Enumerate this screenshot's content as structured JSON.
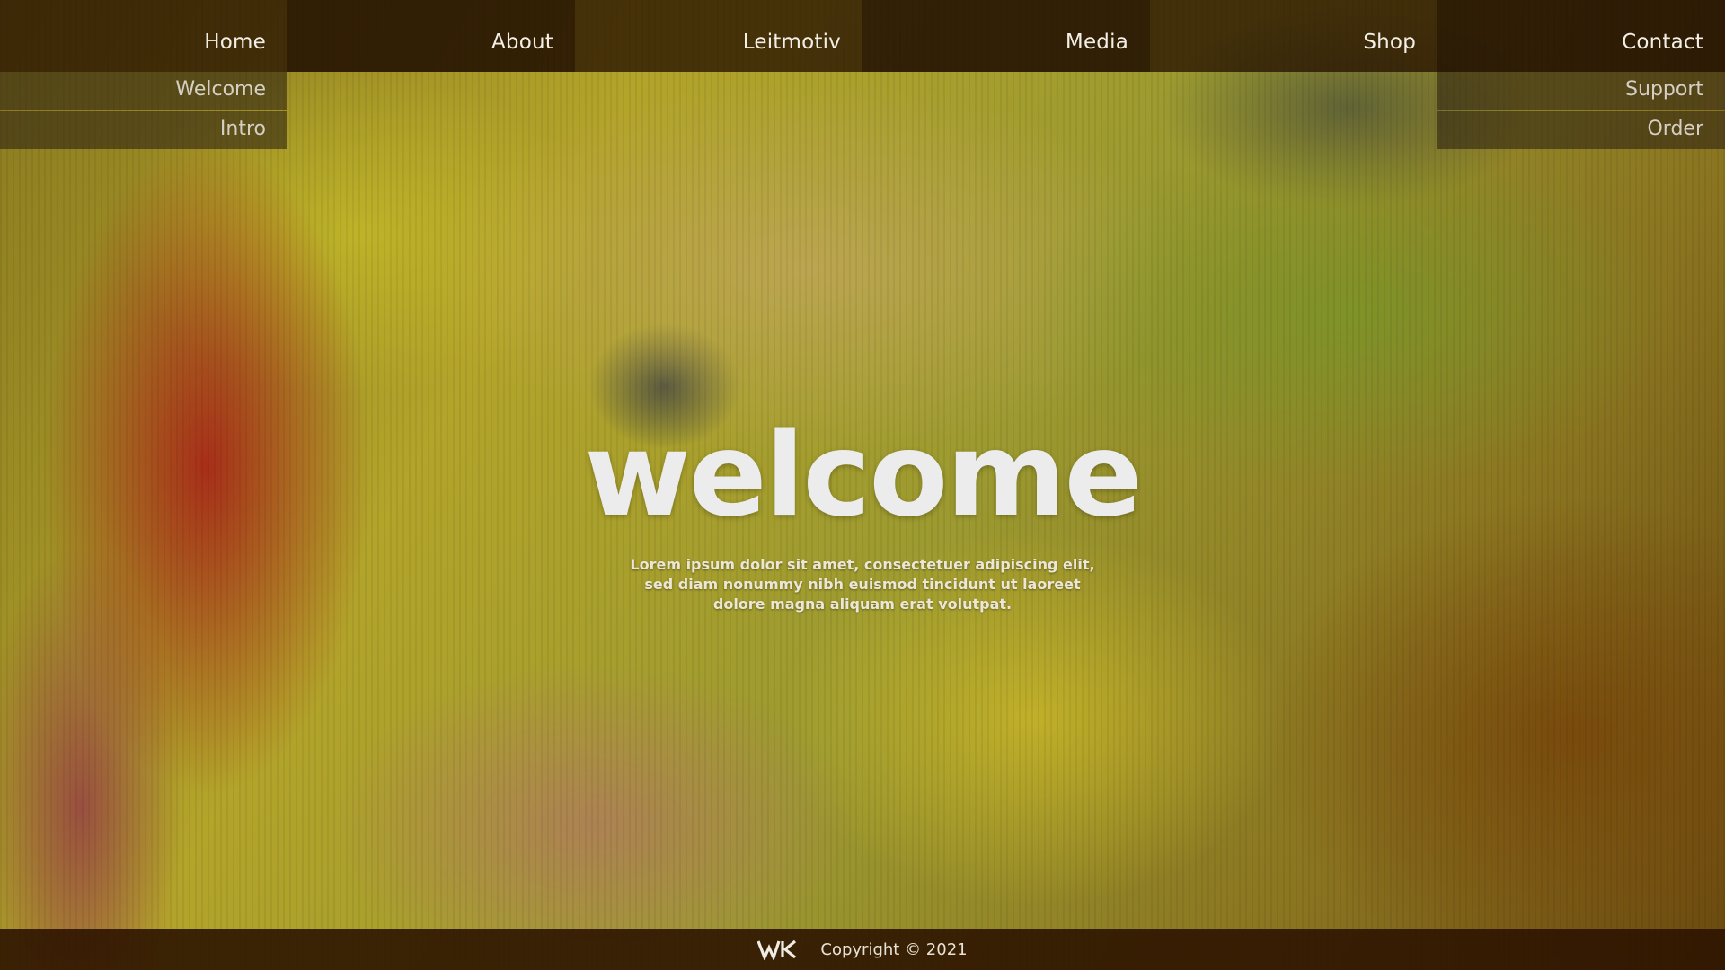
{
  "nav": {
    "items": [
      {
        "label": "Home"
      },
      {
        "label": "About"
      },
      {
        "label": "Leitmotiv"
      },
      {
        "label": "Media"
      },
      {
        "label": "Shop"
      },
      {
        "label": "Contact"
      }
    ],
    "home_submenu": [
      {
        "label": "Welcome"
      },
      {
        "label": "Intro"
      }
    ],
    "contact_submenu": [
      {
        "label": "Support"
      },
      {
        "label": "Order"
      }
    ]
  },
  "hero": {
    "title": "welcome",
    "text": "Lorem ipsum dolor sit amet, consectetuer adipiscing elit, sed diam nonummy nibh euismod tincidunt ut laoreet dolore magna aliquam erat volutpat."
  },
  "footer": {
    "logo_icon": "wk-logo-icon",
    "copyright": "Copyright © 2021"
  },
  "colors": {
    "nav_bg": "#2a1200",
    "footer_bg": "#2d1400",
    "text_light": "#f3efe6"
  }
}
